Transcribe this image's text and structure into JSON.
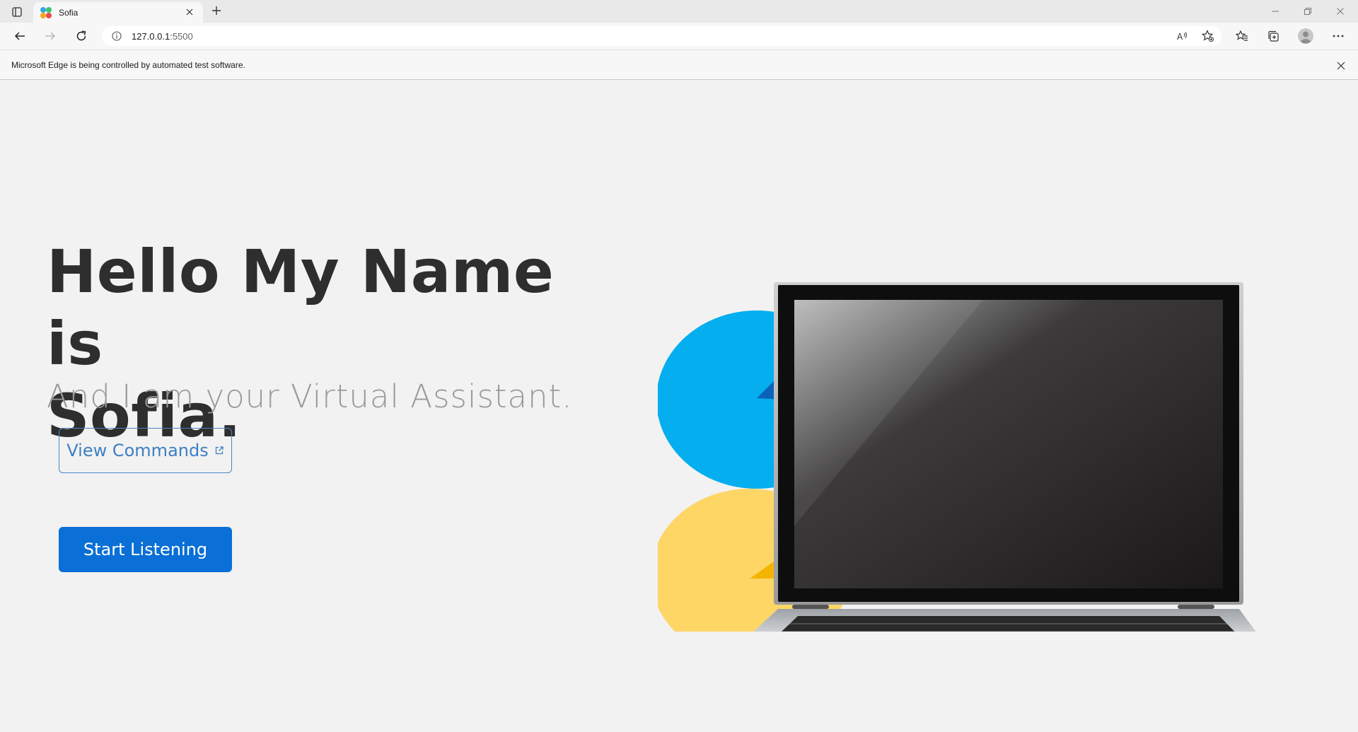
{
  "browser": {
    "tab": {
      "title": "Sofia"
    },
    "address": {
      "host": "127.0.0.1",
      "port": ":5500"
    },
    "infobar": {
      "message": "Microsoft Edge is being controlled by automated test software."
    }
  },
  "hero": {
    "title_line1": "Hello My Name is",
    "title_line2": "Sofia.",
    "subtitle": "And I am your Virtual Assistant.",
    "view_commands_label": "View Commands",
    "start_listening_label": "Start Listening"
  },
  "colors": {
    "accent_blue": "#0a6fd6",
    "bubble_blue": "#04aeef",
    "bubble_yellow": "#fdd666",
    "title_text": "#2e2e2e",
    "subtitle_text": "#9a9a9a"
  },
  "icons": [
    "tab-actions-icon",
    "favicon-icon",
    "close-icon",
    "plus-icon",
    "minimize-icon",
    "restore-icon",
    "back-icon",
    "forward-icon",
    "refresh-icon",
    "info-icon",
    "read-aloud-icon",
    "add-favorite-icon",
    "favorites-icon",
    "collections-icon",
    "profile-icon",
    "more-icon",
    "external-link-icon"
  ]
}
